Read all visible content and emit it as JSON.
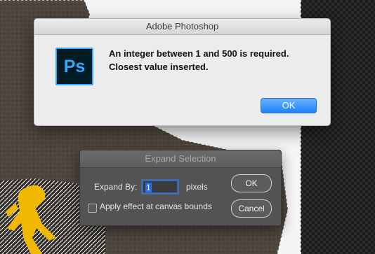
{
  "alert": {
    "title": "Adobe Photoshop",
    "icon_text": "Ps",
    "message_line1": "An integer between 1 and 500 is required.",
    "message_line2": "Closest value inserted.",
    "ok_label": "OK"
  },
  "expand_dialog": {
    "title": "Expand Selection",
    "expand_by_label": "Expand By:",
    "expand_by_value": "1",
    "unit_label": "pixels",
    "apply_label": "Apply effect at canvas bounds",
    "apply_checked": false,
    "ok_label": "OK",
    "cancel_label": "Cancel"
  },
  "colors": {
    "accent": "#1a82fb",
    "photoshop_blue": "#31a8ff",
    "photoshop_dark": "#001d26",
    "dialog_gray": "#535353"
  }
}
